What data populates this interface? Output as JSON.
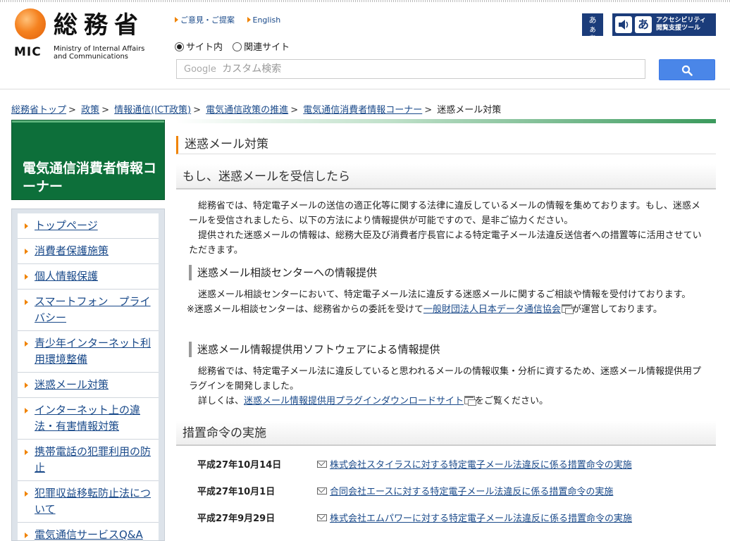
{
  "header": {
    "logo_kanji": "総務省",
    "logo_mic": "MIC",
    "logo_en_line1": "Ministry of Internal Affairs",
    "logo_en_line2": "and Communications",
    "top_links": [
      "ご意見・ご提案",
      "English"
    ],
    "radio_site": "サイト内",
    "radio_related": "関連サイト",
    "search_placeholder": "カスタム検索",
    "search_brand": "Google",
    "font_button": "あぁあ",
    "access_line1": "アクセシビリティ",
    "access_line2": "閲覧支援ツール",
    "access_aa": "あ"
  },
  "breadcrumb": {
    "items": [
      "総務省トップ",
      "政策",
      "情報通信(ICT政策)",
      "電気通信政策の推進",
      "電気通信消費者情報コーナー"
    ],
    "current": "迷惑メール対策",
    "sep": ">"
  },
  "sidebar": {
    "title": "電気通信消費者情報コーナー",
    "items": [
      "トップページ",
      "消費者保護施策",
      "個人情報保護",
      "スマートフォン　プライバシー",
      "青少年インターネット利用環境整備",
      "迷惑メール対策",
      "インターネット上の違法・有害情報対策",
      "携帯電話の犯罪利用の防止",
      "犯罪収益移転防止法について",
      "電気通信サービスQ&A"
    ]
  },
  "main": {
    "page_title": "迷惑メール対策",
    "section1_title": "もし、迷惑メールを受信したら",
    "section1_para1": "　総務省では、特定電子メールの送信の適正化等に関する法律に違反しているメールの情報を集めております。もし、迷惑メールを受信されましたら、以下の方法により情報提供が可能ですので、是非ご協力ください。",
    "section1_para2": "　提供された迷惑メールの情報は、総務大臣及び消費者庁長官による特定電子メール法違反送信者への措置等に活用させていただきます。",
    "sub1_title": "迷惑メール相談センターへの情報提供",
    "sub1_para": "　迷惑メール相談センターにおいて、特定電子メール法に違反する迷惑メールに関するご相談や情報を受付けております。",
    "sub1_note_pre": "※迷惑メール相談センターは、総務省からの委託を受けて",
    "sub1_note_link": "一般財団法人日本データ通信協会",
    "sub1_note_post": "が運営しております。",
    "sub2_title": "迷惑メール情報提供用ソフトウェアによる情報提供",
    "sub2_para": "　総務省では、特定電子メール法に違反していると思われるメールの情報収集・分析に資するため、迷惑メール情報提供用プラグインを開発しました。",
    "sub2_detail_pre": "　詳しくは、",
    "sub2_detail_link": "迷惑メール情報提供用プラグインダウンロードサイト",
    "sub2_detail_post": "をご覧ください。",
    "section2_title": "措置命令の実施",
    "orders": [
      {
        "date": "平成27年10月14日",
        "title": "株式会社スタイラスに対する特定電子メール法違反に係る措置命令の実施"
      },
      {
        "date": "平成27年10月1日",
        "title": "合同会社エースに対する特定電子メール法違反に係る措置命令の実施"
      },
      {
        "date": "平成27年9月29日",
        "title": "株式会社エムパワーに対する特定電子メール法違反に係る措置命令の実施"
      }
    ]
  },
  "colors": {
    "accent_orange": "#f08300",
    "sidebar_green": "#0d6f3a",
    "search_blue": "#4a86e8",
    "link_blue": "#1a4a8a"
  }
}
